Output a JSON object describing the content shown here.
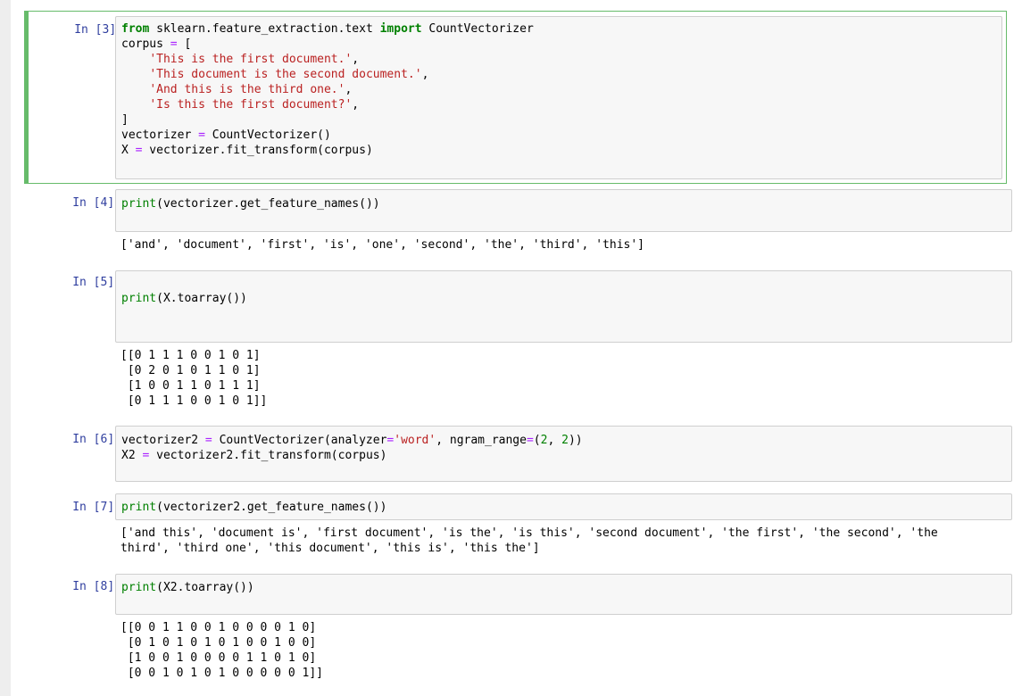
{
  "cells": [
    {
      "prompt": "In [3]:",
      "code": {
        "line1_kw1": "from",
        "line1_mod": " sklearn.feature_extraction.text ",
        "line1_kw2": "import",
        "line1_cls": " CountVectorizer",
        "line2_name": "corpus ",
        "line2_op": "=",
        "line2_rest": " [",
        "strings": [
          "'This is the first document.'",
          "'This document is the second document.'",
          "'And this is the third one.'",
          "'Is this the first document?'"
        ],
        "close": "]",
        "line7_name": "vectorizer ",
        "line7_op": "=",
        "line7_rest": " CountVectorizer()",
        "line8_name": "X ",
        "line8_op": "=",
        "line8_rest": " vectorizer.fit_transform(corpus)"
      }
    },
    {
      "prompt": "In [4]:",
      "code": {
        "fn": "print",
        "rest": "(vectorizer.get_feature_names())"
      },
      "output": "['and', 'document', 'first', 'is', 'one', 'second', 'the', 'third', 'this']"
    },
    {
      "prompt": "In [5]:",
      "code": {
        "fn": "print",
        "rest": "(X.toarray())"
      },
      "output": "[[0 1 1 1 0 0 1 0 1]\n [0 2 0 1 0 1 1 0 1]\n [1 0 0 1 1 0 1 1 1]\n [0 1 1 1 0 0 1 0 1]]"
    },
    {
      "prompt": "In [6]:",
      "code": {
        "l1_a": "vectorizer2 ",
        "l1_op": "=",
        "l1_b": " CountVectorizer(analyzer",
        "l1_op2": "=",
        "l1_str": "'word'",
        "l1_c": ", ngram_range",
        "l1_op3": "=",
        "l1_d": "(",
        "l1_n1": "2",
        "l1_e": ", ",
        "l1_n2": "2",
        "l1_f": "))",
        "l2_a": "X2 ",
        "l2_op": "=",
        "l2_b": " vectorizer2.fit_transform(corpus)"
      }
    },
    {
      "prompt": "In [7]:",
      "code": {
        "fn": "print",
        "rest": "(vectorizer2.get_feature_names())"
      },
      "output": "['and this', 'document is', 'first document', 'is the', 'is this', 'second document', 'the first', 'the second', 'the\nthird', 'third one', 'this document', 'this is', 'this the']"
    },
    {
      "prompt": "In [8]:",
      "code": {
        "fn": "print",
        "rest": "(X2.toarray())"
      },
      "output": "[[0 0 1 1 0 0 1 0 0 0 0 1 0]\n [0 1 0 1 0 1 0 1 0 0 1 0 0]\n [1 0 0 1 0 0 0 0 1 1 0 1 0]\n [0 0 1 0 1 0 1 0 0 0 0 0 1]]"
    }
  ]
}
